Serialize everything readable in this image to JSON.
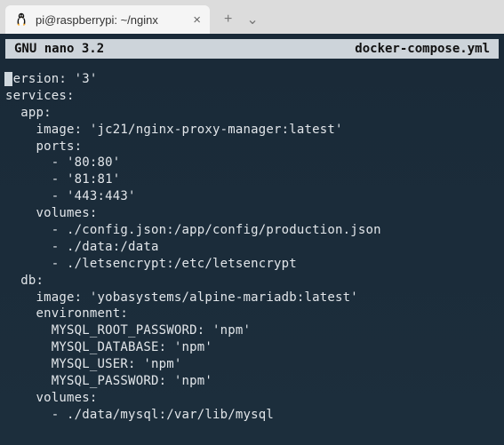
{
  "tab": {
    "title": "pi@raspberrypi: ~/nginx",
    "close": "×",
    "new_tab": "+",
    "chevron": "⌄"
  },
  "nano": {
    "app": "GNU nano 3.2",
    "filename": "docker-compose.yml"
  },
  "file_content": "version: '3'\nservices:\n  app:\n    image: 'jc21/nginx-proxy-manager:latest'\n    ports:\n      - '80:80'\n      - '81:81'\n      - '443:443'\n    volumes:\n      - ./config.json:/app/config/production.json\n      - ./data:/data\n      - ./letsencrypt:/etc/letsencrypt\n  db:\n    image: 'yobasystems/alpine-mariadb:latest'\n    environment:\n      MYSQL_ROOT_PASSWORD: 'npm'\n      MYSQL_DATABASE: 'npm'\n      MYSQL_USER: 'npm'\n      MYSQL_PASSWORD: 'npm'\n    volumes:\n      - ./data/mysql:/var/lib/mysql"
}
